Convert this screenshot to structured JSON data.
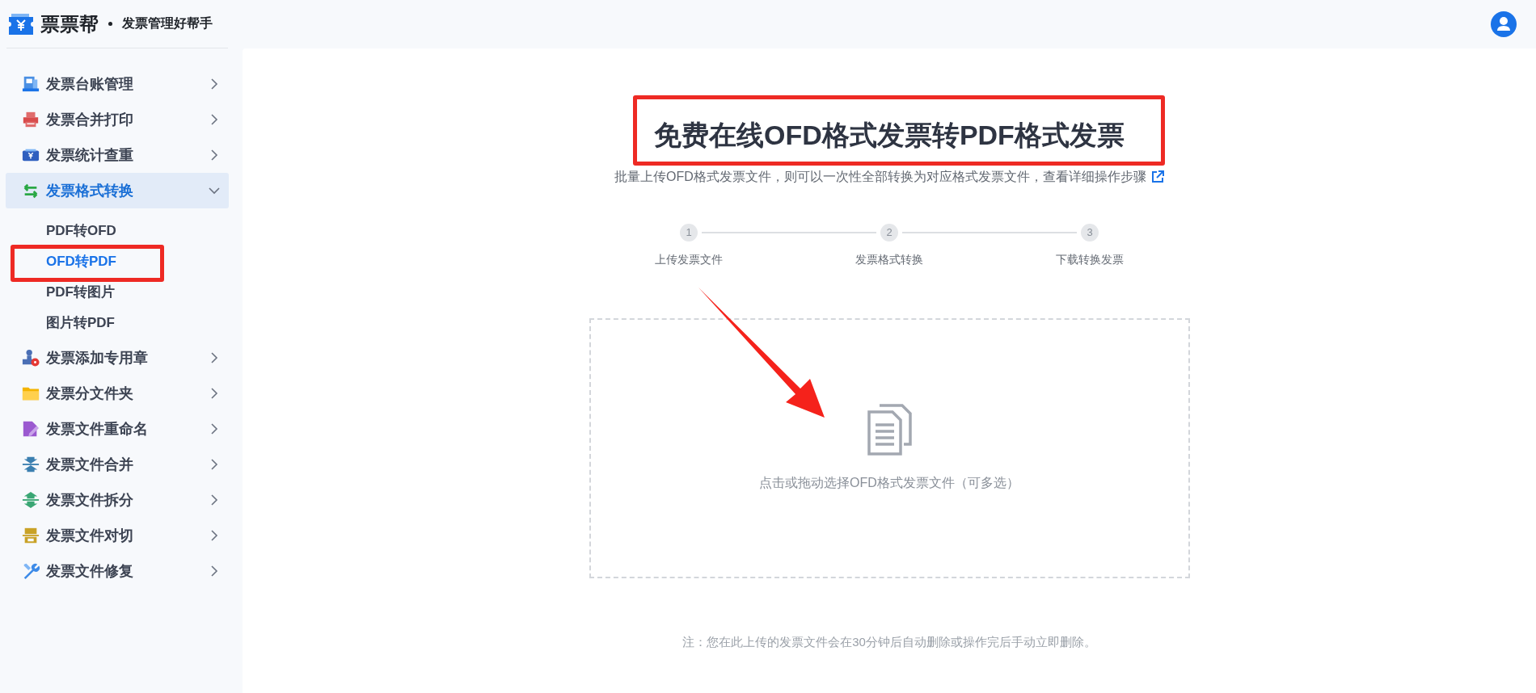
{
  "header": {
    "brand": "票票帮",
    "tagline": "发票管理好帮手"
  },
  "sidebar": {
    "items": [
      {
        "label": "发票台账管理",
        "expanded": false
      },
      {
        "label": "发票合并打印",
        "expanded": false
      },
      {
        "label": "发票统计查重",
        "expanded": false
      },
      {
        "label": "发票格式转换",
        "expanded": true,
        "children": [
          {
            "label": "PDF转OFD",
            "selected": false
          },
          {
            "label": "OFD转PDF",
            "selected": true
          },
          {
            "label": "PDF转图片",
            "selected": false
          },
          {
            "label": "图片转PDF",
            "selected": false
          }
        ]
      },
      {
        "label": "发票添加专用章",
        "expanded": false
      },
      {
        "label": "发票分文件夹",
        "expanded": false
      },
      {
        "label": "发票文件重命名",
        "expanded": false
      },
      {
        "label": "发票文件合并",
        "expanded": false
      },
      {
        "label": "发票文件拆分",
        "expanded": false
      },
      {
        "label": "发票文件对切",
        "expanded": false
      },
      {
        "label": "发票文件修复",
        "expanded": false
      }
    ]
  },
  "main": {
    "title": "免费在线OFD格式发票转PDF格式发票",
    "subtitle": "批量上传OFD格式发票文件，则可以一次性全部转换为对应格式发票文件，查看详细操作步骤",
    "steps": [
      {
        "number": "1",
        "label": "上传发票文件"
      },
      {
        "number": "2",
        "label": "发票格式转换"
      },
      {
        "number": "3",
        "label": "下载转换发票"
      }
    ],
    "upload": {
      "hint": "点击或拖动选择OFD格式发票文件（可多选）"
    },
    "note": "注：您在此上传的发票文件会在30分钟后自动删除或操作完后手动立即删除。"
  }
}
